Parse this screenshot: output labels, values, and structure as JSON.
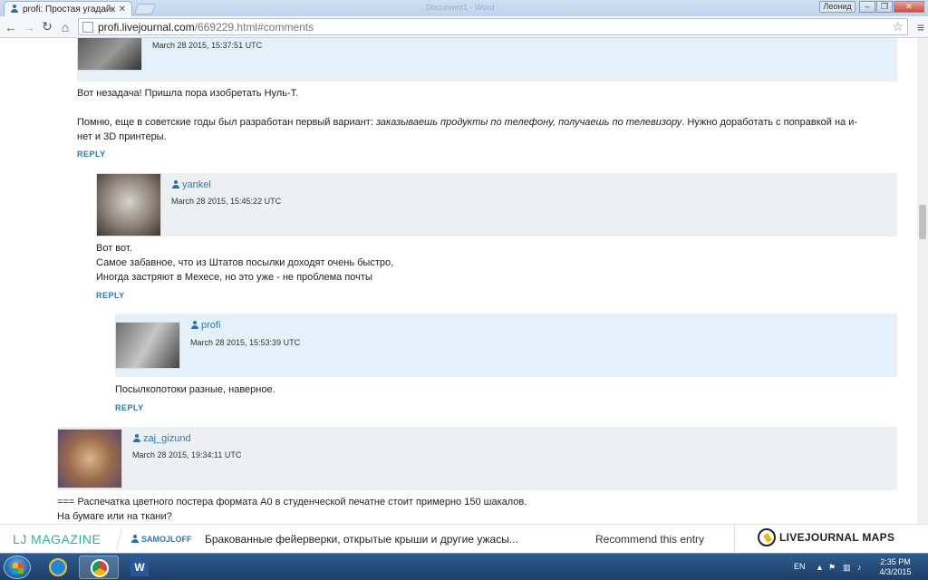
{
  "browser": {
    "tab_title": "profi: Простая угадайка",
    "ghost_title": "Document1 - Word",
    "user_chip": "Леонид",
    "url_host": "profi.livejournal.com",
    "url_path": "/669229.html#comments"
  },
  "comments": [
    {
      "date": "March 28 2015, 15:37:51 UTC",
      "text_line1": "Вот незадача! Пришла пора изобретать Нуль-Т.",
      "text_line2_plain": "Помню, еще в советские годы был разработан первый вариант: ",
      "text_line2_italic": "заказываешь продукты по телефону, получаешь по телевизору",
      "text_line2_tail": ". Нужно доработать с поправкой на и-",
      "text_line3": "нет и 3D принтеры.",
      "reply": "REPLY"
    },
    {
      "user": "yankel",
      "date": "March 28 2015, 15:45:22 UTC",
      "lines": [
        "Вот вот.",
        "Самое забавное, что из Штатов посылки доходят очень быстро,",
        "Иногда застряют в Мехесе, но это уже - не проблема почты"
      ],
      "reply": "REPLY"
    },
    {
      "user": "profi",
      "date": "March 28 2015, 15:53:39 UTC",
      "lines": [
        "Посылкопотоки разные, наверное."
      ],
      "reply": "REPLY"
    },
    {
      "user": "zaj_gizund",
      "date": "March 28 2015, 19:34:11 UTC",
      "lines": [
        "=== Распечатка цветного постера формата А0 в студенческой печатне стоит примерно 150 шакалов.",
        "На бумаге или на ткани?"
      ]
    }
  ],
  "ljbar": {
    "magazine": "LJ MAGAZINE",
    "author": "SAMOJLOFF",
    "headline": "Бракованные фейерверки, открытые крыши и другие ужасы...",
    "recommend": "Recommend this entry",
    "logo_text": "LIVEJOURNAL MAPS"
  },
  "taskbar": {
    "lang": "EN",
    "time": "2:35 PM",
    "date": "4/3/2015"
  },
  "colors": {
    "link": "#2a7ab3",
    "blue_header": "#e5f1fa",
    "gray_header": "#edf0f2",
    "lj_magazine": "#2bb0a2"
  }
}
